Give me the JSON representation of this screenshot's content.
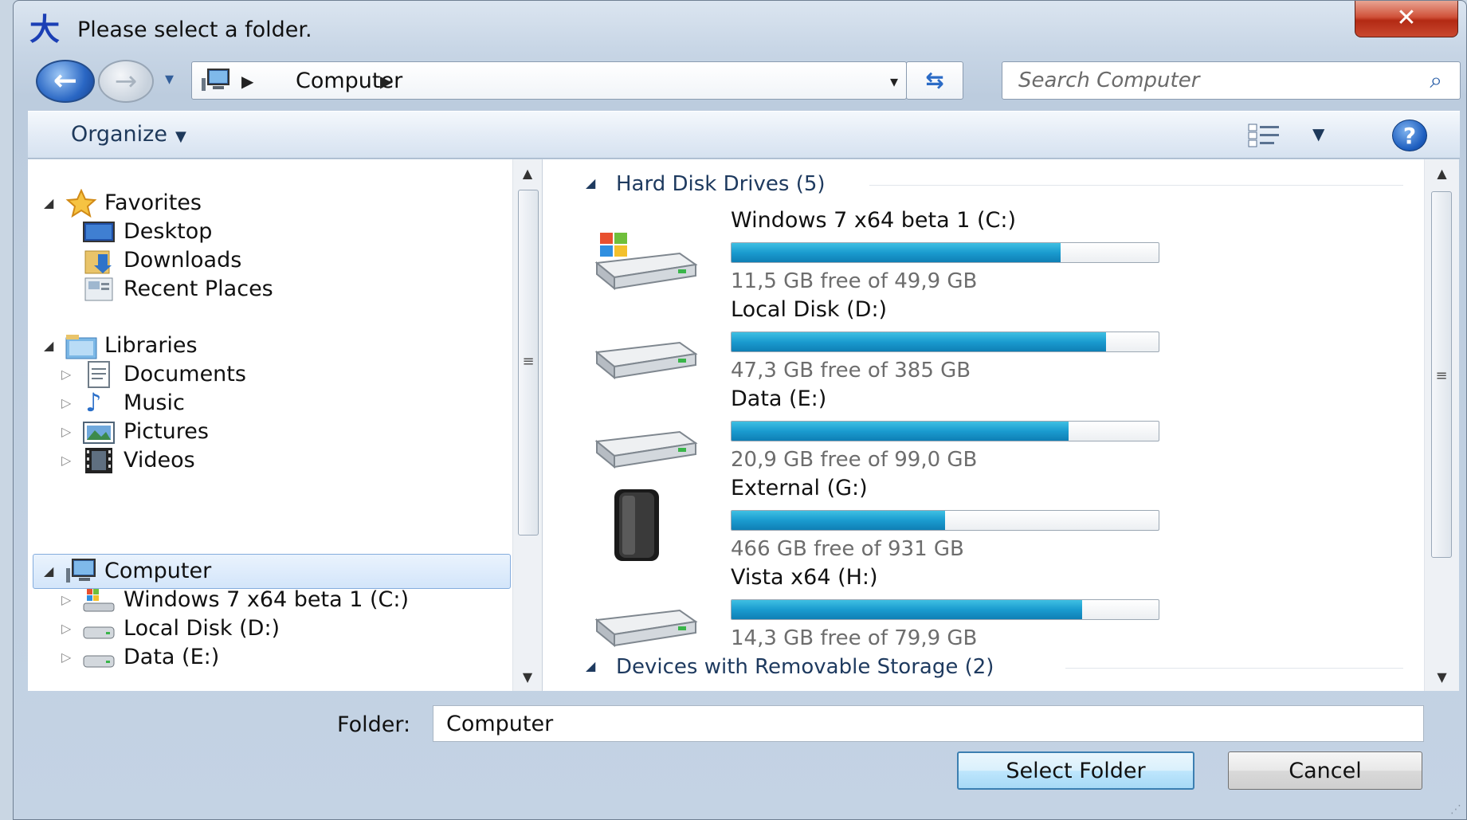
{
  "window": {
    "title": "Please select a folder.",
    "app_icon_glyph": "大",
    "close_glyph": "✕"
  },
  "nav": {
    "back_glyph": "←",
    "forward_glyph": "→",
    "breadcrumb": [
      "Computer"
    ],
    "dropdown_glyph": "▾",
    "refresh_glyph": "⇆"
  },
  "search": {
    "placeholder": "Search Computer",
    "icon": "search-icon"
  },
  "command_bar": {
    "organize_label": "Organize",
    "help_glyph": "?"
  },
  "sidebar": {
    "favorites": {
      "label": "Favorites",
      "items": [
        {
          "label": "Desktop",
          "icon": "desktop-icon"
        },
        {
          "label": "Downloads",
          "icon": "downloads-folder-icon"
        },
        {
          "label": "Recent Places",
          "icon": "recent-places-icon"
        }
      ]
    },
    "libraries": {
      "label": "Libraries",
      "items": [
        {
          "label": "Documents",
          "icon": "documents-icon"
        },
        {
          "label": "Music",
          "icon": "music-icon"
        },
        {
          "label": "Pictures",
          "icon": "pictures-icon"
        },
        {
          "label": "Videos",
          "icon": "videos-icon"
        }
      ]
    },
    "computer": {
      "label": "Computer",
      "items": [
        {
          "label": "Windows 7 x64 beta 1 (C:)",
          "icon": "windows-drive-icon"
        },
        {
          "label": "Local Disk (D:)",
          "icon": "drive-icon"
        },
        {
          "label": "Data (E:)",
          "icon": "drive-icon"
        }
      ]
    }
  },
  "content": {
    "hard_disk_header": "Hard Disk Drives (5)",
    "removable_header": "Devices with Removable Storage (2)",
    "drives": [
      {
        "name": "Windows 7 x64 beta 1 (C:)",
        "free_text": "11,5 GB free of 49,9 GB",
        "used_fraction": 0.77,
        "icon": "windows-drive-icon"
      },
      {
        "name": "Local Disk (D:)",
        "free_text": "47,3 GB free of 385 GB",
        "used_fraction": 0.877,
        "icon": "hard-drive-icon"
      },
      {
        "name": "Data (E:)",
        "free_text": "20,9 GB free of 99,0 GB",
        "used_fraction": 0.789,
        "icon": "hard-drive-icon"
      },
      {
        "name": "External (G:)",
        "free_text": "466 GB free of 931 GB",
        "used_fraction": 0.5,
        "icon": "external-drive-icon"
      },
      {
        "name": "Vista x64 (H:)",
        "free_text": "14,3 GB free of 79,9 GB",
        "used_fraction": 0.821,
        "icon": "hard-drive-icon"
      }
    ]
  },
  "footer": {
    "folder_label": "Folder:",
    "folder_value": "Computer",
    "select_button": "Select Folder",
    "cancel_button": "Cancel"
  }
}
